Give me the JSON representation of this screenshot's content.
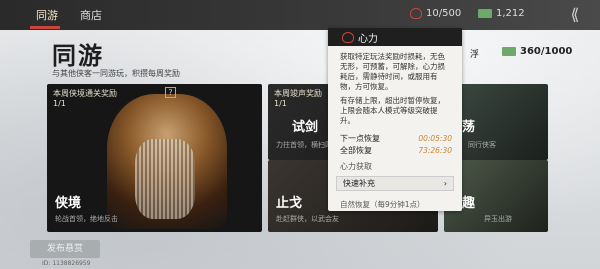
{
  "topbar": {
    "tabs": [
      "同游",
      "商店"
    ],
    "heart_value": "10/500",
    "money_value": "1,212"
  },
  "page": {
    "title": "同游",
    "subtitle": "与其他侠客一同游玩，积攒每周奖励"
  },
  "counter": {
    "label": "浮",
    "value": "360/1000"
  },
  "cards": {
    "main": {
      "tag": "本周侠境通关奖励",
      "count": "1/1",
      "help": "?",
      "name": "侠境",
      "desc": "轮战首领，绝地反击"
    },
    "mid_top": {
      "tag": "本周竣声奖励",
      "count": "1/1",
      "name": "试剑",
      "desc": "力拄首领，横扫四方"
    },
    "mid_bot": {
      "name": "止戈",
      "desc": "赴赶群侠，以武会友"
    },
    "right_top": {
      "name": "荡",
      "desc": "同行侠客"
    },
    "right_bot": {
      "name": "趣",
      "desc": "异玉出游"
    }
  },
  "popup": {
    "title": "心力",
    "para1": "获取特定玩法奖励时损耗，无色无形，可预蓄，可解除，心力损耗后，需静待时间，或服用有物，方可恢复。",
    "para2": "有存储上限，超出时暂停恢复，上限会随本人模式等级突破提升。",
    "next_label": "下一点恢复",
    "next_value": "00:05:30",
    "full_label": "全部恢复",
    "full_value": "73:26:30",
    "gain_section": "心力获取",
    "quick_btn": "快速补充",
    "natural": "自然恢复（每9分钟1点）"
  },
  "footer": {
    "publish": "发布悬赏",
    "uid": "ID: 1138826959"
  },
  "colors": {
    "accent": "#c9453a",
    "timer": "#c9863a",
    "money": "#6fa86b"
  }
}
